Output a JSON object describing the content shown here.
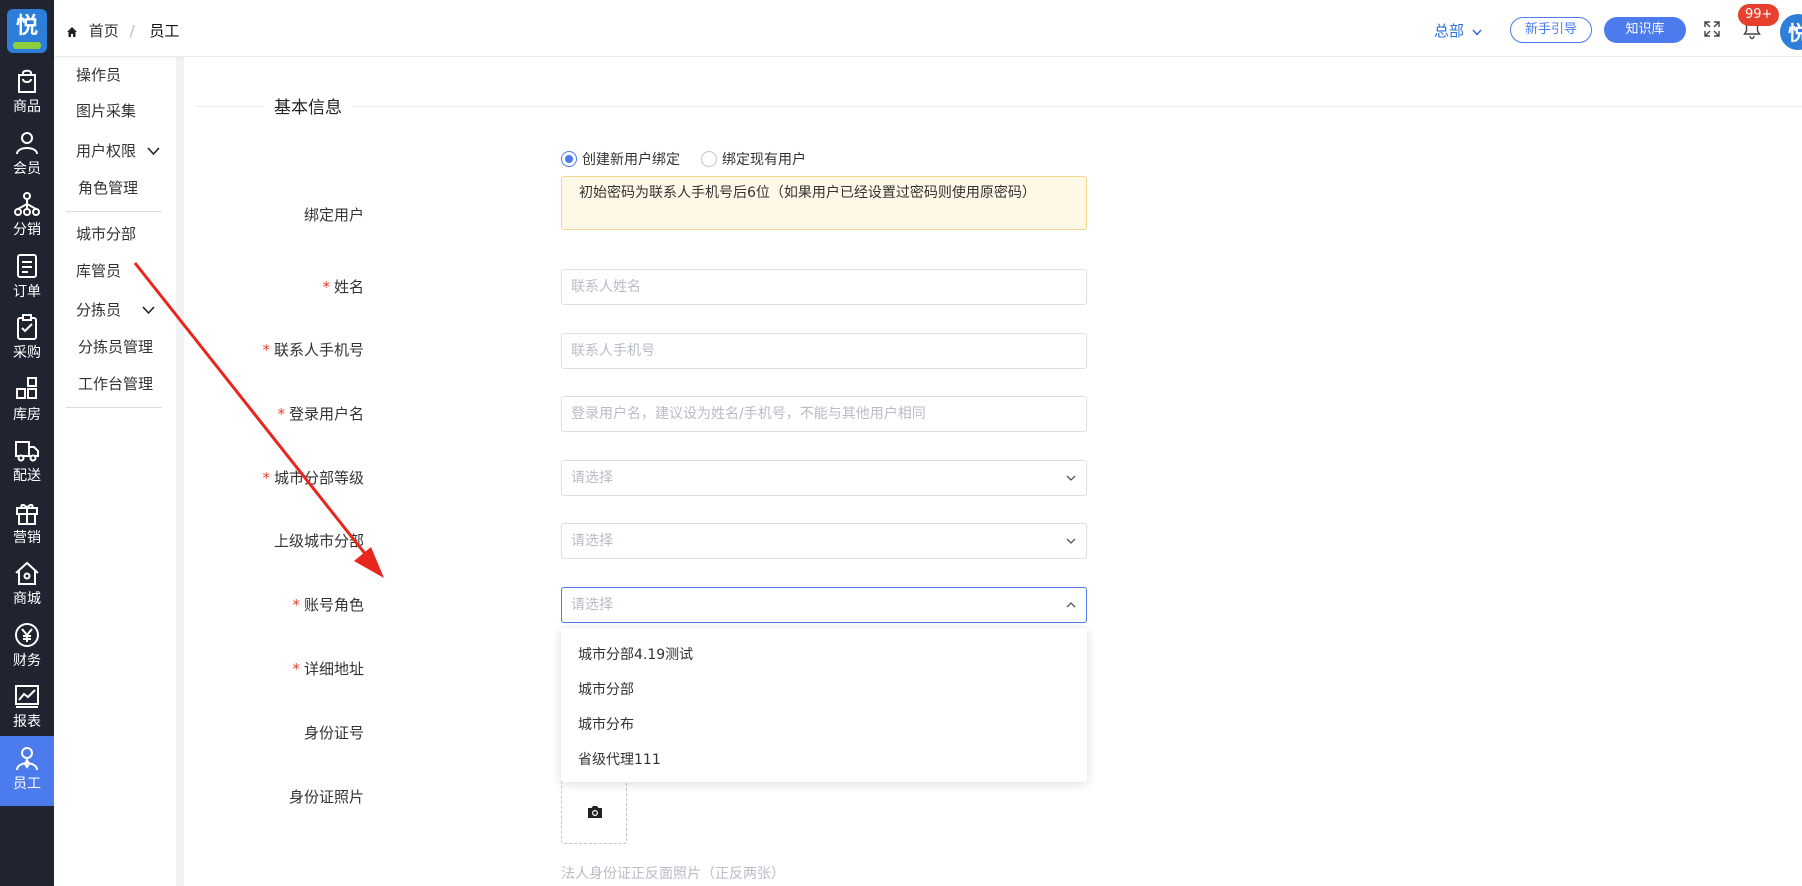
{
  "brand": {
    "logo_char": "悦",
    "avatar_char": "悦"
  },
  "rail": [
    {
      "label": "商品",
      "icon": "bag-icon"
    },
    {
      "label": "会员",
      "icon": "user-icon"
    },
    {
      "label": "分销",
      "icon": "network-icon"
    },
    {
      "label": "订单",
      "icon": "order-icon"
    },
    {
      "label": "采购",
      "icon": "clipboard-icon"
    },
    {
      "label": "库房",
      "icon": "warehouse-icon"
    },
    {
      "label": "配送",
      "icon": "truck-icon"
    },
    {
      "label": "营销",
      "icon": "gift-icon"
    },
    {
      "label": "商城",
      "icon": "home-icon"
    },
    {
      "label": "财务",
      "icon": "yen-icon"
    },
    {
      "label": "报表",
      "icon": "chart-icon"
    },
    {
      "label": "员工",
      "icon": "staff-icon",
      "active": true
    }
  ],
  "submenu": {
    "operator": "操作员",
    "photo": "图片采集",
    "user_perm": "用户权限",
    "role_mgmt": "角色管理",
    "city_branch": "城市分部",
    "warehouse_keeper": "库管员",
    "sorter": "分拣员",
    "sorter_mgmt": "分拣员管理",
    "workbench_mgmt": "工作台管理"
  },
  "topbar": {
    "home": "首页",
    "separator": "/",
    "current": "员工",
    "hq": "总部",
    "guide": "新手引导",
    "knowledge": "知识库",
    "badge": "99+"
  },
  "form": {
    "section_title": "基本信息",
    "bind_user_label": "绑定用户",
    "bind_new": "创建新用户绑定",
    "bind_existing": "绑定现有用户",
    "notice": "初始密码为联系人手机号后6位（如果用户已经设置过密码则使用原密码）",
    "name_label": "姓名",
    "name_placeholder": "联系人姓名",
    "phone_label": "联系人手机号",
    "phone_placeholder": "联系人手机号",
    "login_label": "登录用户名",
    "login_placeholder": "登录用户名，建议设为姓名/手机号，不能与其他用户相同",
    "level_label": "城市分部等级",
    "level_placeholder": "请选择",
    "parent_label": "上级城市分部",
    "parent_placeholder": "请选择",
    "role_label": "账号角色",
    "role_placeholder": "请选择",
    "address_label": "详细地址",
    "idno_label": "身份证号",
    "idphoto_label": "身份证照片",
    "idphoto_hint": "法人身份证正反面照片（正反两张）"
  },
  "role_options": [
    "城市分部4.19测试",
    "城市分部",
    "城市分布",
    "省级代理111"
  ],
  "colors": {
    "accent": "#4b7bec",
    "rail_bg": "#1f2430",
    "required": "#e7412d",
    "annotation": "#e8261c"
  }
}
